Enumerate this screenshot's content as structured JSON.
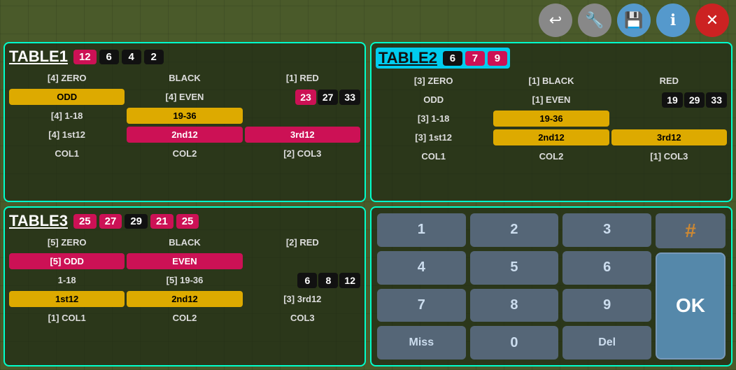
{
  "toolbar": {
    "back_label": "↩",
    "wrench_label": "🔧",
    "save_label": "💾",
    "info_label": "ℹ",
    "close_label": "✕"
  },
  "table1": {
    "title": "TABLE1",
    "header_numbers": [
      {
        "value": "12",
        "color": "red"
      },
      {
        "value": "6",
        "color": "black"
      },
      {
        "value": "4",
        "color": "black"
      },
      {
        "value": "2",
        "color": "black"
      }
    ],
    "rows": {
      "row1": {
        "col1": "[4] ZERO",
        "col2": "BLACK",
        "col3": "[1] RED"
      },
      "row2": {
        "col1_yellow": "ODD",
        "col2": "[4] EVEN",
        "numbers": [
          "23",
          "27",
          "33"
        ],
        "num_colors": [
          "red",
          "black",
          "black"
        ]
      },
      "row3": {
        "col1": "[4] 1-18",
        "col2_yellow": "19-36",
        "col3": ""
      },
      "row4": {
        "col1": "[4] 1st12",
        "col2_red": "2nd12",
        "col3_red": "3rd12"
      },
      "row5": {
        "col1": "COL1",
        "col2": "COL2",
        "col3": "[2] COL3"
      }
    }
  },
  "table2": {
    "title": "TABLE2",
    "header_numbers": [
      {
        "value": "6",
        "color": "black"
      },
      {
        "value": "7",
        "color": "red"
      },
      {
        "value": "9",
        "color": "red"
      }
    ],
    "rows": {
      "row1": {
        "col1": "[3] ZERO",
        "col2": "[1] BLACK",
        "col3": "RED"
      },
      "row2": {
        "col1": "ODD",
        "col2": "[1] EVEN",
        "numbers": [
          "19",
          "29",
          "33"
        ],
        "num_colors": [
          "black",
          "black",
          "black"
        ]
      },
      "row3": {
        "col1": "[3] 1-18",
        "col2_yellow": "19-36",
        "col3": ""
      },
      "row4": {
        "col1": "[3] 1st12",
        "col2_yellow": "2nd12",
        "col3_yellow": "3rd12"
      },
      "row5": {
        "col1": "COL1",
        "col2": "COL2",
        "col3": "[1] COL3"
      }
    }
  },
  "table3": {
    "title": "TABLE3",
    "header_numbers": [
      {
        "value": "25",
        "color": "red"
      },
      {
        "value": "27",
        "color": "red"
      },
      {
        "value": "29",
        "color": "black"
      },
      {
        "value": "21",
        "color": "red"
      },
      {
        "value": "25",
        "color": "red"
      }
    ],
    "rows": {
      "row1": {
        "col1": "[5] ZERO",
        "col2": "BLACK",
        "col3": "[2] RED"
      },
      "row2": {
        "col1_red": "[5] ODD",
        "col2_red": "EVEN",
        "col3": ""
      },
      "row3": {
        "col1": "1-18",
        "col2": "[5] 19-36",
        "numbers": [
          "6",
          "8",
          "12"
        ],
        "num_colors": [
          "black",
          "black",
          "black"
        ]
      },
      "row4": {
        "col1_yellow": "1st12",
        "col2_yellow": "2nd12",
        "col3": "[3] 3rd12"
      },
      "row5": {
        "col1": "[1] COL1",
        "col2": "COL2",
        "col3": "COL3"
      }
    }
  },
  "numpad": {
    "buttons": [
      "1",
      "2",
      "3",
      "4",
      "5",
      "6",
      "7",
      "8",
      "9",
      "Miss",
      "0",
      "Del"
    ],
    "hash": "#",
    "ok": "OK"
  }
}
